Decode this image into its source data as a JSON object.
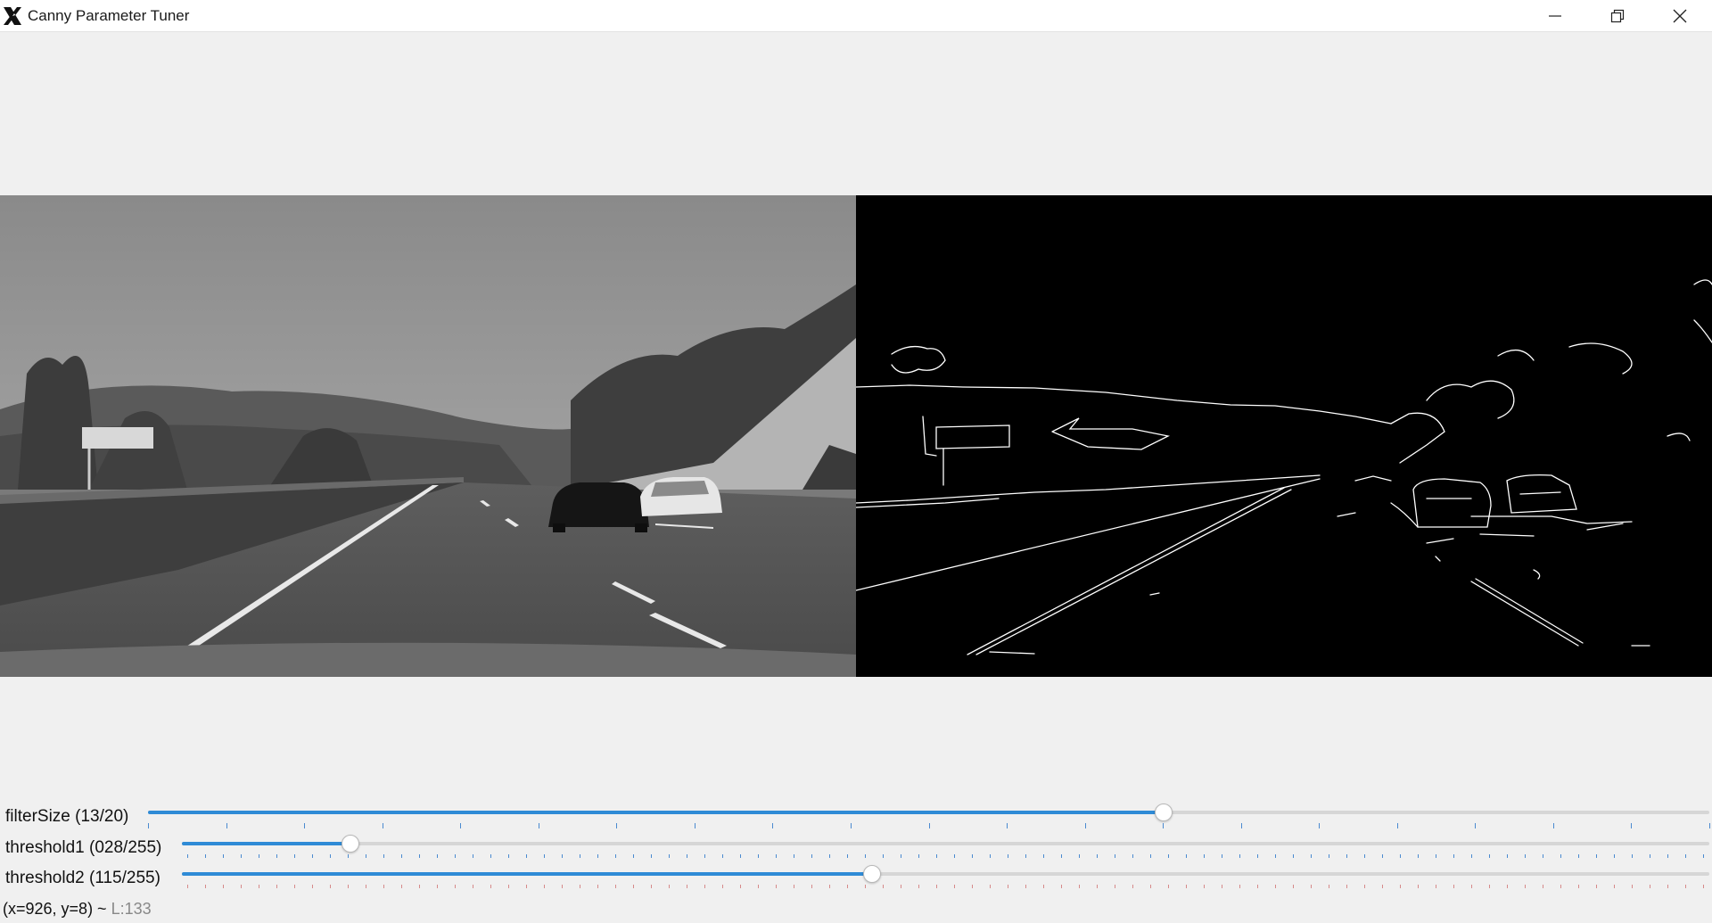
{
  "window": {
    "title": "Canny Parameter Tuner"
  },
  "title_icons": {
    "app": "x11-app-icon",
    "minimize": "minimize-icon",
    "maximize": "restore-icon",
    "close": "close-icon"
  },
  "images": {
    "original": "grayscale-highway-road-image",
    "edges": "canny-edge-detection-output-image"
  },
  "trackbars": [
    {
      "label": "filterSize (13/20)",
      "value": 13,
      "max": 20
    },
    {
      "label": "threshold1 (028/255)",
      "value": 28,
      "max": 255
    },
    {
      "label": "threshold2 (115/255)",
      "value": 115,
      "max": 255
    }
  ],
  "status": {
    "coords": "(x=926, y=8) ~",
    "value": "L:133"
  },
  "colors": {
    "accent": "#2f8bd6",
    "background": "#f0f0f0",
    "titlebar": "#ffffff"
  }
}
